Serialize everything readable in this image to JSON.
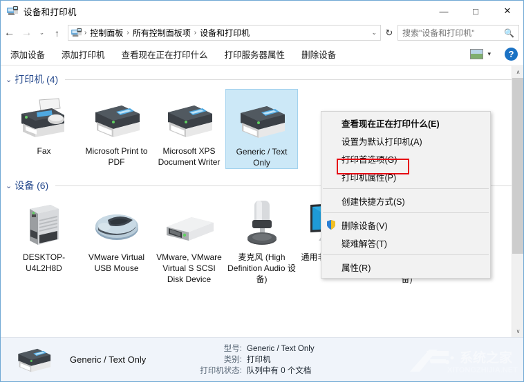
{
  "window": {
    "title": "设备和打印机",
    "title_icon": "devices-printers-icon",
    "minimize_label": "—",
    "maximize_label": "□",
    "close_label": "✕"
  },
  "navigation": {
    "back_label": "←",
    "forward_label": "→",
    "recent_label": "⌄",
    "up_label": "↑",
    "refresh_label": "↻",
    "address_dropdown": "⌄",
    "breadcrumbs": [
      {
        "label": "控制面板"
      },
      {
        "label": "所有控制面板项"
      },
      {
        "label": "设备和打印机"
      }
    ],
    "separator": "›"
  },
  "search": {
    "placeholder": "搜索\"设备和打印机\"",
    "value": "",
    "icon": "search-icon"
  },
  "commandbar": {
    "items": [
      {
        "label": "添加设备",
        "name": "add-device"
      },
      {
        "label": "添加打印机",
        "name": "add-printer"
      },
      {
        "label": "查看现在正在打印什么",
        "name": "see-whats-printing"
      },
      {
        "label": "打印服务器属性",
        "name": "print-server-properties"
      },
      {
        "label": "删除设备",
        "name": "remove-device"
      }
    ],
    "view_dropdown": "▾",
    "help_label": "?"
  },
  "sections": [
    {
      "name": "printers",
      "title": "打印机 (4)",
      "count": 4,
      "chevron": "⌄",
      "items": [
        {
          "label": "Fax",
          "icon": "fax-printer-icon",
          "selected": false
        },
        {
          "label": "Microsoft Print to PDF",
          "icon": "printer-icon",
          "selected": false
        },
        {
          "label": "Microsoft XPS Document Writer",
          "icon": "printer-icon",
          "selected": false
        },
        {
          "label": "Generic / Text Only",
          "icon": "printer-icon",
          "selected": true
        }
      ]
    },
    {
      "name": "devices",
      "title": "设备 (6)",
      "count": 6,
      "chevron": "⌄",
      "items": [
        {
          "label": "DESKTOP-U4L2H8D",
          "icon": "desktop-tower-icon",
          "selected": false
        },
        {
          "label": "VMware Virtual USB Mouse",
          "icon": "mouse-icon",
          "selected": false
        },
        {
          "label": "VMware, VMware Virtual S SCSI Disk Device",
          "icon": "disk-drive-icon",
          "selected": false
        },
        {
          "label": "麦克风 (High Definition Audio 设备)",
          "icon": "microphone-icon",
          "selected": false
        },
        {
          "label": "通用非即插即用监视器",
          "icon": "monitor-icon",
          "selected": false
        },
        {
          "label": "扬声器 (High Definition Audio 设备)",
          "icon": "speaker-icon",
          "selected": false
        }
      ]
    }
  ],
  "context_menu": {
    "items": [
      {
        "label": "查看现在正在打印什么(E)",
        "bold": true,
        "shield": false,
        "name": "see-whats-printing"
      },
      {
        "label": "设置为默认打印机(A)",
        "bold": false,
        "shield": false,
        "name": "set-as-default-printer"
      },
      {
        "label": "打印首选项(G)",
        "bold": false,
        "shield": false,
        "name": "printing-preferences"
      },
      {
        "label": "打印机属性(P)",
        "bold": false,
        "shield": false,
        "name": "printer-properties",
        "highlighted": true
      },
      {
        "separator": true
      },
      {
        "label": "创建快捷方式(S)",
        "bold": false,
        "shield": false,
        "name": "create-shortcut"
      },
      {
        "separator": true
      },
      {
        "label": "删除设备(V)",
        "bold": false,
        "shield": true,
        "name": "remove-device"
      },
      {
        "label": "疑难解答(T)",
        "bold": false,
        "shield": false,
        "name": "troubleshoot"
      },
      {
        "separator": true
      },
      {
        "label": "属性(R)",
        "bold": false,
        "shield": false,
        "name": "properties"
      }
    ],
    "highlight_color": "#e60012"
  },
  "details_pane": {
    "device_name": "Generic / Text Only",
    "icon": "printer-icon",
    "rows": [
      {
        "key": "型号:",
        "value": "Generic / Text Only"
      },
      {
        "key": "类别:",
        "value": "打印机"
      },
      {
        "key": "打印机状态:",
        "value": "队列中有 0 个文档"
      }
    ]
  },
  "scrollbar": {
    "up_arrow": "∧",
    "down_arrow": "∨"
  },
  "watermark": {
    "text": "系统之家",
    "subtext": "XITONGZHIJIA.NET"
  },
  "colors": {
    "section_title": "#24488c",
    "selection": "#cce8f7",
    "highlight": "#e60012",
    "accent": "#1b72c4"
  }
}
